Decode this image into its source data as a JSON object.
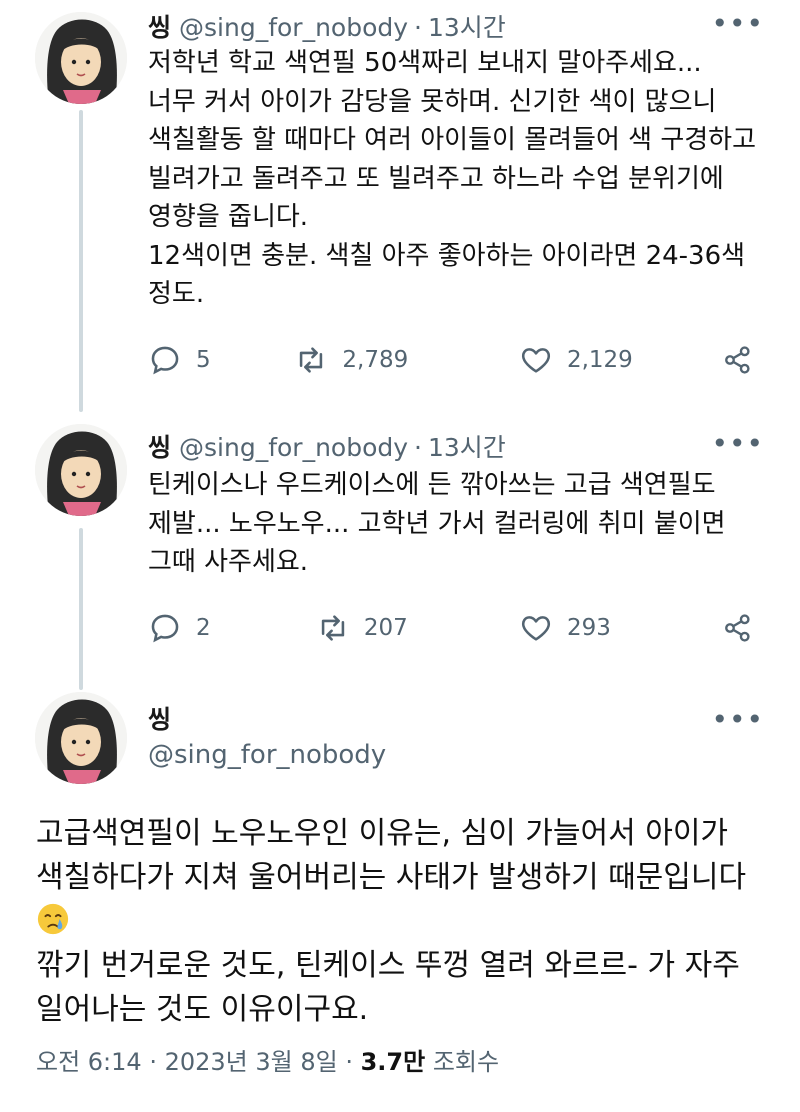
{
  "colors": {
    "text": "#111111",
    "muted": "#536471",
    "thread_line": "#cfd9de",
    "background": "#ffffff"
  },
  "icons": {
    "reply": "speech-bubble-icon",
    "retweet": "retweet-icon",
    "like": "heart-icon",
    "share": "share-icon",
    "more": "ellipsis-icon",
    "emoji": "crying-face-emoji"
  },
  "tweets": [
    {
      "name": "씽",
      "handle": "@sing_for_nobody",
      "separator": "·",
      "time": "13시간",
      "more": "•••",
      "text": "저학년 학교 색연필 50색짜리 보내지 말아주세요...\n너무 커서 아이가 감당을 못하며. 신기한 색이 많으니 색칠활동 할 때마다 여러 아이들이 몰려들어 색 구경하고 빌려가고 돌려주고 또 빌려주고 하느라 수업 분위기에 영향을 줍니다.\n12색이면 충분. 색칠 아주 좋아하는 아이라면 24-36색 정도.",
      "replies": "5",
      "retweets": "2,789",
      "likes": "2,129"
    },
    {
      "name": "씽",
      "handle": "@sing_for_nobody",
      "separator": "·",
      "time": "13시간",
      "more": "•••",
      "text": "틴케이스나 우드케이스에 든 깎아쓰는 고급 색연필도 제발... 노우노우... 고학년 가서 컬러링에 취미 붙이면 그때 사주세요.",
      "replies": "2",
      "retweets": "207",
      "likes": "293"
    }
  ],
  "main_tweet": {
    "name": "씽",
    "handle": "@sing_for_nobody",
    "more": "•••",
    "text_part1": "고급색연필이 노우노우인 이유는, 심이 가늘어서 아이가 색칠하다가 지쳐 울어버리는 사태가 발생하기 때문입니다",
    "text_part2": "\n깎기 번거로운 것도, 틴케이스 뚜껑 열려 와르르- 가 자주 일어나는 것도 이유이구요.",
    "time": "오전 6:14",
    "sep1": " · ",
    "date": "2023년 3월 8일",
    "sep2": " · ",
    "views": "3.7만",
    "views_label": " 조회수"
  }
}
